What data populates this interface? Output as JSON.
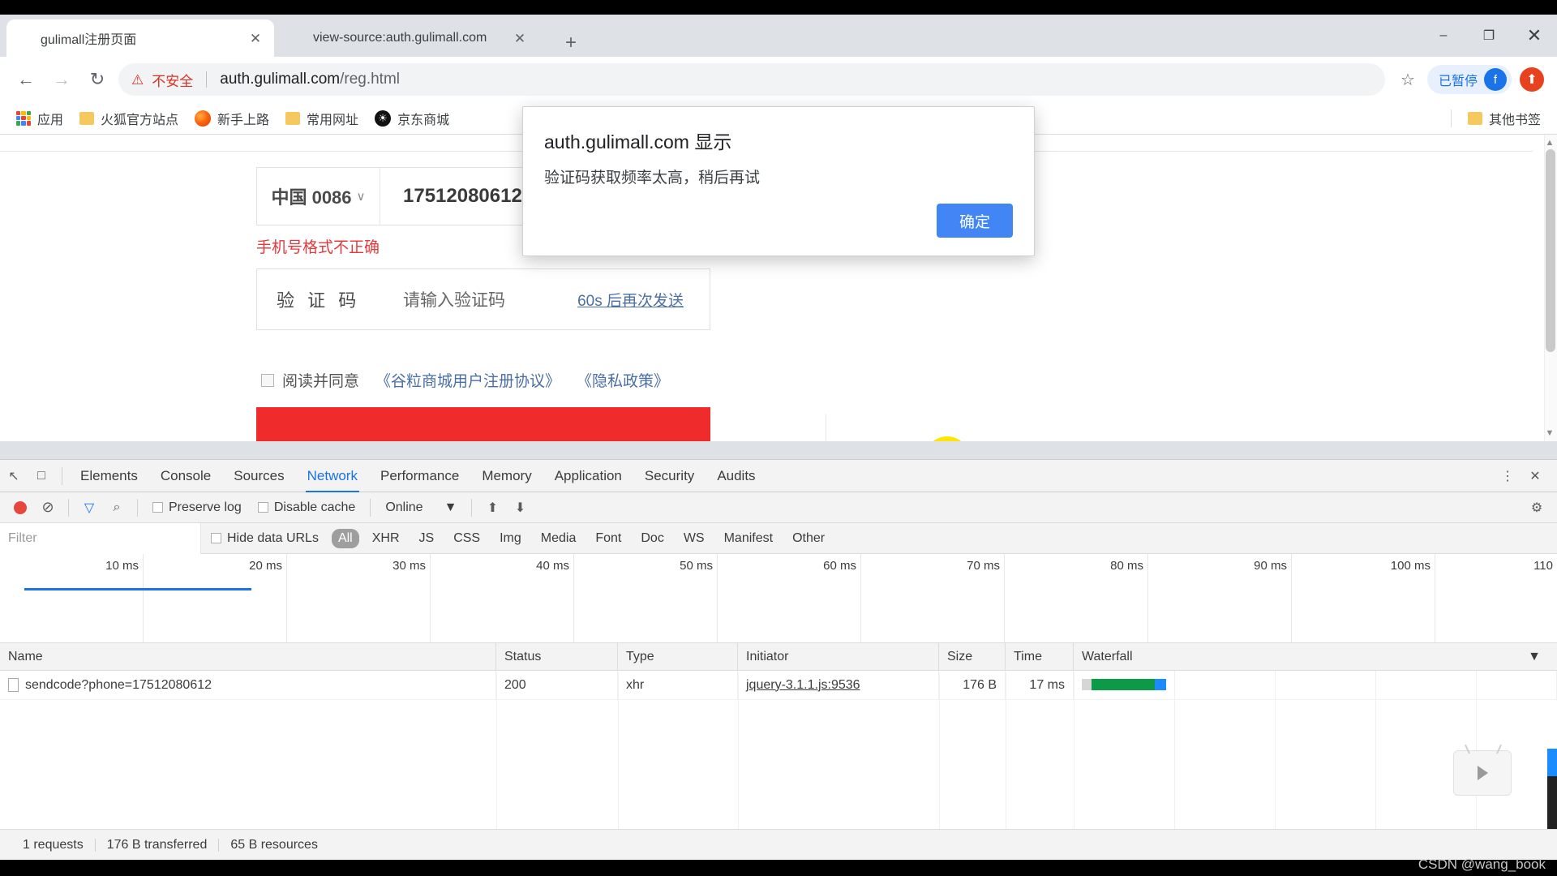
{
  "window": {
    "controls": {
      "minimize": "–",
      "maximize": "❐",
      "close": "✕"
    }
  },
  "tabs": [
    {
      "title": "gulimall注册页面",
      "active": true,
      "close": "✕",
      "favicon": "leaf-icon"
    },
    {
      "title": "view-source:auth.gulimall.com",
      "active": false,
      "close": "✕",
      "favicon": "leaf-icon"
    }
  ],
  "new_tab_label": "+",
  "toolbar": {
    "back": "←",
    "forward": "→",
    "reload": "↻",
    "security_warning_icon": "⚠",
    "security_warning_text": "不安全",
    "url_host": "auth.gulimall.com",
    "url_path": "/reg.html",
    "bookmark_star": "☆",
    "paused_label": "已暂停",
    "avatar_letter": "f",
    "extension_icon": "⬆"
  },
  "bookmarks": {
    "items": [
      {
        "label": "应用",
        "icon": "apps-grid-icon"
      },
      {
        "label": "火狐官方站点",
        "icon": "folder-icon"
      },
      {
        "label": "新手上路",
        "icon": "firefox-icon"
      },
      {
        "label": "常用网址",
        "icon": "folder-icon"
      },
      {
        "label": "京东商城",
        "icon": "globe-icon"
      }
    ],
    "other": {
      "label": "其他书签",
      "icon": "folder-icon"
    }
  },
  "page": {
    "country_label": "中国 0086",
    "country_caret": "∨",
    "phone_value": "17512080612",
    "phone_error": "手机号格式不正确",
    "code_label": "验 证 码",
    "code_placeholder": "请输入验证码",
    "resend_label": "60s 后再次发送",
    "agree_text": "阅读并同意",
    "agree_link_1": "《谷粒商城用户注册协议》",
    "agree_link_2": "《隐私政策》",
    "submit_label": "",
    "cursor_glyph": "I"
  },
  "alert": {
    "title": "auth.gulimall.com 显示",
    "message": "验证码获取频率太高，稍后再试",
    "ok_label": "确定",
    "ok_color": "#4285f4"
  },
  "devtools": {
    "tabs": [
      {
        "label": "Elements",
        "active": false
      },
      {
        "label": "Console",
        "active": false
      },
      {
        "label": "Sources",
        "active": false
      },
      {
        "label": "Network",
        "active": true
      },
      {
        "label": "Performance",
        "active": false
      },
      {
        "label": "Memory",
        "active": false
      },
      {
        "label": "Application",
        "active": false
      },
      {
        "label": "Security",
        "active": false
      },
      {
        "label": "Audits",
        "active": false
      }
    ],
    "inspect_icon": "↖",
    "device_icon": "□",
    "more_icon": "⋮",
    "close_icon": "✕",
    "settings_icon": "⚙",
    "controls": {
      "record_label": "",
      "clear_label": "⊘",
      "filter_label": "▽",
      "search_label": "⌕",
      "preserve_log": "Preserve log",
      "disable_cache": "Disable cache",
      "throttling": "Online",
      "throttling_caret": "▼",
      "import_icon": "⬆",
      "export_icon": "⬇"
    },
    "filterbar": {
      "filter_placeholder": "Filter",
      "hide_data_urls": "Hide data URLs",
      "types": [
        {
          "label": "All",
          "selected": true
        },
        {
          "label": "XHR",
          "selected": false
        },
        {
          "label": "JS",
          "selected": false
        },
        {
          "label": "CSS",
          "selected": false
        },
        {
          "label": "Img",
          "selected": false
        },
        {
          "label": "Media",
          "selected": false
        },
        {
          "label": "Font",
          "selected": false
        },
        {
          "label": "Doc",
          "selected": false
        },
        {
          "label": "WS",
          "selected": false
        },
        {
          "label": "Manifest",
          "selected": false
        },
        {
          "label": "Other",
          "selected": false
        }
      ]
    },
    "timeline": {
      "ticks": [
        "10 ms",
        "20 ms",
        "30 ms",
        "40 ms",
        "50 ms",
        "60 ms",
        "70 ms",
        "80 ms",
        "90 ms",
        "100 ms",
        "110"
      ]
    },
    "table": {
      "columns": [
        "Name",
        "Status",
        "Type",
        "Initiator",
        "Size",
        "Time",
        "Waterfall"
      ],
      "sort_caret": "▼",
      "rows": [
        {
          "name": "sendcode?phone=17512080612",
          "status": "200",
          "type": "xhr",
          "initiator": "jquery-3.1.1.js:9536",
          "size": "176 B",
          "time": "17 ms"
        }
      ]
    },
    "status": {
      "requests": "1 requests",
      "transferred": "176 B transferred",
      "resources": "65 B resources"
    }
  },
  "watermark": "CSDN @wang_book"
}
